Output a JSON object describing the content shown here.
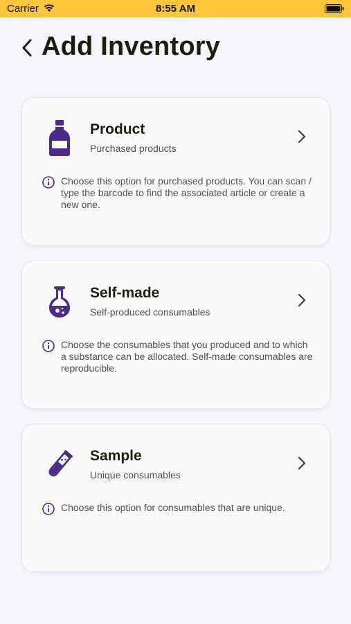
{
  "status_bar": {
    "carrier": "Carrier",
    "time": "8:55 AM"
  },
  "header": {
    "title": "Add Inventory"
  },
  "options": [
    {
      "title": "Product",
      "subtitle": "Purchased products",
      "info": "Choose this option for purchased products. You can scan / type the barcode to find the associated article or create a new one.",
      "icon": "bottle-icon"
    },
    {
      "title": "Self-made",
      "subtitle": "Self-produced consumables",
      "info": "Choose the consumables that you produced and to which a substance can be allocated. Self-made consumables are reproducible.",
      "icon": "flask-icon"
    },
    {
      "title": "Sample",
      "subtitle": "Unique consumables",
      "info": "Choose this option for consumables that are unique.",
      "icon": "test-tube-icon"
    }
  ],
  "colors": {
    "status_bar": "#fcc63a",
    "accent": "#4b2a8c",
    "background": "#f5f5fb"
  }
}
